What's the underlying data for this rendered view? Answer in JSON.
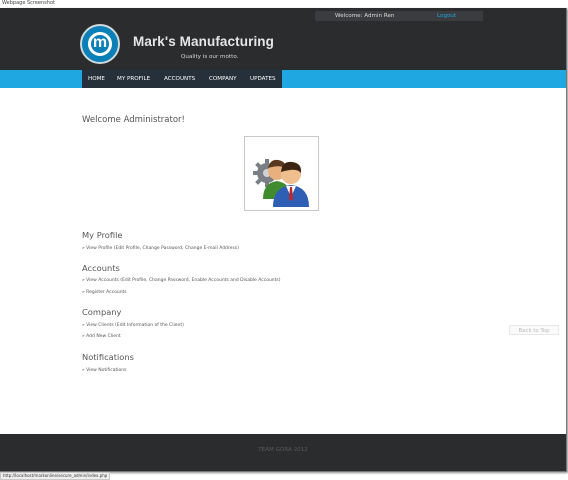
{
  "screenshot_caption": "Webpage Screenshot",
  "header": {
    "welcome_text": "Welcome: Admin Ren",
    "logout_label": "Logout",
    "logo_letter": "m",
    "site_title": "Mark's Manufacturing",
    "motto": "Quality is our motto."
  },
  "nav": {
    "items": [
      "HOME",
      "MY PROFILE",
      "ACCOUNTS",
      "COMPANY",
      "UPDATES"
    ]
  },
  "main": {
    "title": "Welcome Administrator!",
    "avatar_icon": "admin-users-icon",
    "back_to_top": "Back to Top",
    "sections": [
      {
        "title": "My Profile",
        "links": [
          "» View Profile (Edit Profile, Change Password, Change E-mail Address)"
        ]
      },
      {
        "title": "Accounts",
        "links": [
          "» View Accounts (Edit Profile, Change Password, Enable Accounts and Disable Accounts)",
          "» Register Accounts"
        ]
      },
      {
        "title": "Company",
        "links": [
          "» View Clients (Edit Information of the Client)",
          "» Add New Client"
        ]
      },
      {
        "title": "Notifications",
        "links": [
          "» View Notifications"
        ]
      }
    ]
  },
  "footer": {
    "text": "TEAM GORA 2012"
  },
  "status_bar": {
    "url": "http://localhost/markonline/secure_admin/index.php"
  },
  "colors": {
    "header_bg": "#2b2c2e",
    "nav_bar": "#1ea7e0",
    "nav_inner": "#26303a",
    "logout_link": "#1ea7e0",
    "logo_blue": "#0b7fb8"
  }
}
